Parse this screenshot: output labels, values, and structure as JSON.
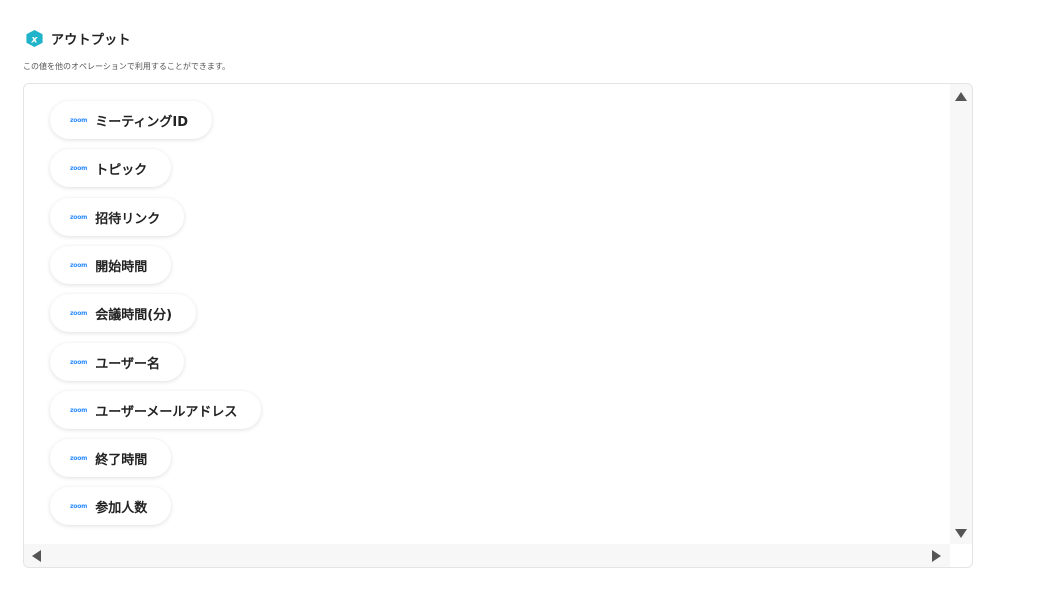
{
  "header": {
    "title": "アウトプット",
    "badge_letter": "x",
    "badge_color": "#1fb4c9"
  },
  "description": "この値を他のオペレーションで利用することができます。",
  "outputs": {
    "logo_text": "zoom",
    "items": [
      {
        "label": "ミーティングID"
      },
      {
        "label": "トピック"
      },
      {
        "label": "招待リンク"
      },
      {
        "label": "開始時間"
      },
      {
        "label": "会議時間(分)"
      },
      {
        "label": "ユーザー名"
      },
      {
        "label": "ユーザーメールアドレス"
      },
      {
        "label": "終了時間"
      },
      {
        "label": "参加人数"
      }
    ]
  },
  "colors": {
    "zoom_blue": "#2d8cff",
    "scrollbar_track": "#f7f7f7",
    "scroll_arrow": "#555555"
  },
  "icons": {
    "badge": "variable-x-icon",
    "zoom_logo": "zoom-logo-icon",
    "scroll_up": "scroll-up-arrow-icon",
    "scroll_down": "scroll-down-arrow-icon",
    "scroll_left": "scroll-left-arrow-icon",
    "scroll_right": "scroll-right-arrow-icon"
  }
}
